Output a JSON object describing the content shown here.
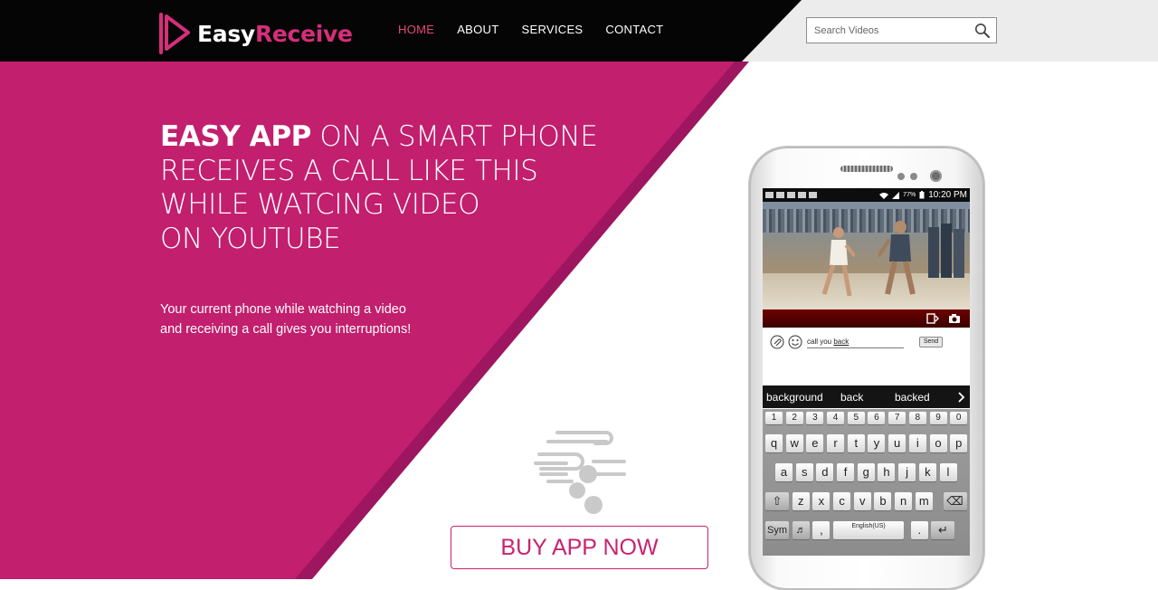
{
  "brand": {
    "name_part1": "Easy",
    "name_part2": "Receive",
    "logo_icon": "play-triangle-icon",
    "colors": {
      "accent": "#d62e7b",
      "magenta_bg": "#c21f6e",
      "header_bg": "#050505"
    }
  },
  "nav": {
    "items": [
      {
        "label": "HOME",
        "active": true
      },
      {
        "label": "ABOUT",
        "active": false
      },
      {
        "label": "SERVICES",
        "active": false
      },
      {
        "label": "CONTACT",
        "active": false
      }
    ]
  },
  "search": {
    "placeholder": "Search Videos",
    "icon": "search-icon"
  },
  "hero": {
    "headline_bold": "EASY APP",
    "headline_line1_rest": " ON A SMART PHONE",
    "headline_line2": "RECEIVES A CALL LIKE THIS",
    "headline_line3": "WHILE WATCING VIDEO",
    "headline_line4": "ON YOUTUBE",
    "sub_line1": "Your current phone while watching a video",
    "sub_line2": "and receiving a call gives you interruptions!"
  },
  "cta": {
    "label": "BUY APP NOW"
  },
  "phone": {
    "status_time": "10:20 PM",
    "status_battery": "77%",
    "chat_text": "call you",
    "chat_underlined": "back",
    "send_label": "Send",
    "suggestions": [
      "background",
      "back",
      "backed"
    ],
    "keys_row1": [
      "1",
      "2",
      "3",
      "4",
      "5",
      "6",
      "7",
      "8",
      "9",
      "0"
    ],
    "keys_row2": [
      "q",
      "w",
      "e",
      "r",
      "t",
      "y",
      "u",
      "i",
      "o",
      "p"
    ],
    "keys_row3": [
      "a",
      "s",
      "d",
      "f",
      "g",
      "h",
      "j",
      "k",
      "l"
    ],
    "keys_row4": [
      "z",
      "x",
      "c",
      "v",
      "b",
      "n",
      "m"
    ],
    "key_sym": "Sym",
    "key_space": "English(US)",
    "key_comma": ",",
    "key_dot": "."
  }
}
